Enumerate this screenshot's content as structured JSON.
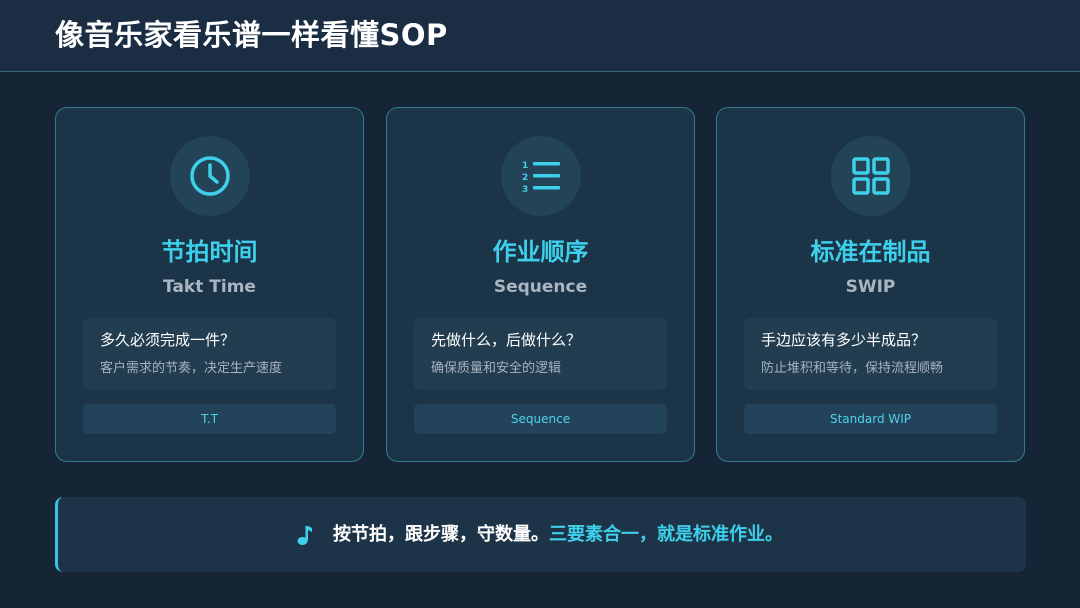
{
  "page_title": "像音乐家看乐谱一样看懂SOP",
  "colors": {
    "background": "#162536",
    "card_border": "#2f7d8d",
    "accent": "#3ed0ea"
  },
  "cards": [
    {
      "icon": "clock-icon",
      "title": "节拍时间",
      "subtitle": "Takt Time",
      "question": "多久必须完成一件？",
      "answer": "客户需求的节奏，决定生产速度",
      "tag": "T.T"
    },
    {
      "icon": "numbered-list-icon",
      "title": "作业顺序",
      "subtitle": "Sequence",
      "question": "先做什么，后做什么？",
      "answer": "确保质量和安全的逻辑",
      "tag": "Sequence"
    },
    {
      "icon": "grid-icon",
      "title": "标准在制品",
      "subtitle": "SWIP",
      "question": "手边应该有多少半成品？",
      "answer": "防止堆积和等待，保持流程顺畅",
      "tag": "Standard WIP"
    }
  ],
  "summary": {
    "icon": "music-note-icon",
    "text": "按节拍，跟步骤，守数量。",
    "highlight": "三要素合一，就是标准作业。"
  }
}
